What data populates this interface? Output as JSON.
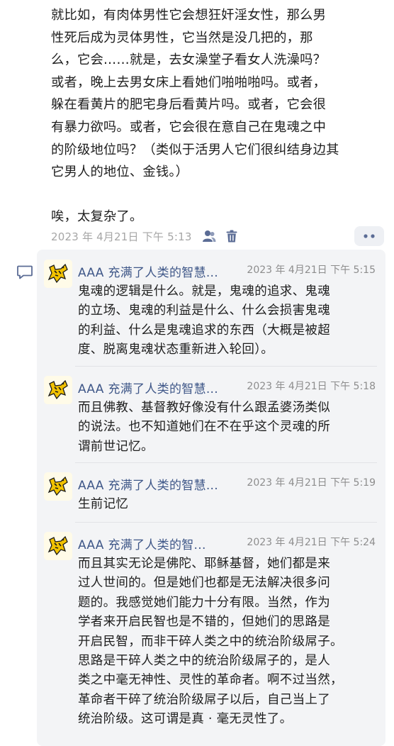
{
  "post": {
    "body": "就比如，有肉体男性它会想狂奸淫女性，那么男\n性死后成为灵体男性，它当然是没几把的，那\n么，它会……就是，去女澡堂子看女人洗澡吗？\n或者，晚上去男女床上看她们啪啪啪吗。或者，\n躲在看黄片的肥宅身后看黄片吗。或者，它会很\n有暴力欲吗。或者，它会很在意自己在鬼魂之中\n的阶级地位吗？（类似于活男人它们很纠结身边其\n它男人的地位、金钱。）\n\n唉，太复杂了。",
    "timestamp": "2023 年 4月21日  下午 5:13",
    "icons": [
      "friends-visibility-icon",
      "delete-icon",
      "more-icon"
    ]
  },
  "comments": [
    {
      "author": "AAA 充满了人类的智慧...",
      "time": "2023 年 4月21日 下午 5:15",
      "text": "鬼魂的逻辑是什么。就是，鬼魂的追求、鬼魂\n的立场、鬼魂的利益是什么、什么会损害鬼魂\n的利益、什么是鬼魂追求的东西（大概是被超\n度、脱离鬼魂状态重新进入轮回）。"
    },
    {
      "author": "AAA 充满了人类的智慧...",
      "time": "2023 年 4月21日 下午 5:18",
      "text": "而且佛教、基督教好像没有什么跟孟婆汤类似\n的说法。也不知道她们在不在乎这个灵魂的所\n谓前世记忆。"
    },
    {
      "author": "AAA 充满了人类的智慧...",
      "time": "2023 年 4月21日 下午 5:19",
      "text": "生前记忆"
    },
    {
      "author": "AAA 充满了人类的智...",
      "time": "2023 年 4月21日 下午 5:24",
      "text": "而且其实无论是佛陀、耶稣基督，她们都是来\n过人世间的。但是她们也都是无法解决很多问\n题的。我感觉她们能力十分有限。当然，作为\n学者来开启民智也是不错的，但她们的思路是\n开启民智，而非干碎人类之中的统治阶级屌子。\n思路是干碎人类之中的统治阶级屌子的，是人\n类之中毫无神性、灵性的革命者。啊不过当然，\n革命者干碎了统治阶级屌子以后，自己当上了\n统治阶级。这可谓是真 · 毫无灵性了。"
    }
  ],
  "colors": {
    "name": "#3f5788",
    "time": "#8d8d8d",
    "panel": "#f3f4f6",
    "accent": "#5b6c95"
  }
}
